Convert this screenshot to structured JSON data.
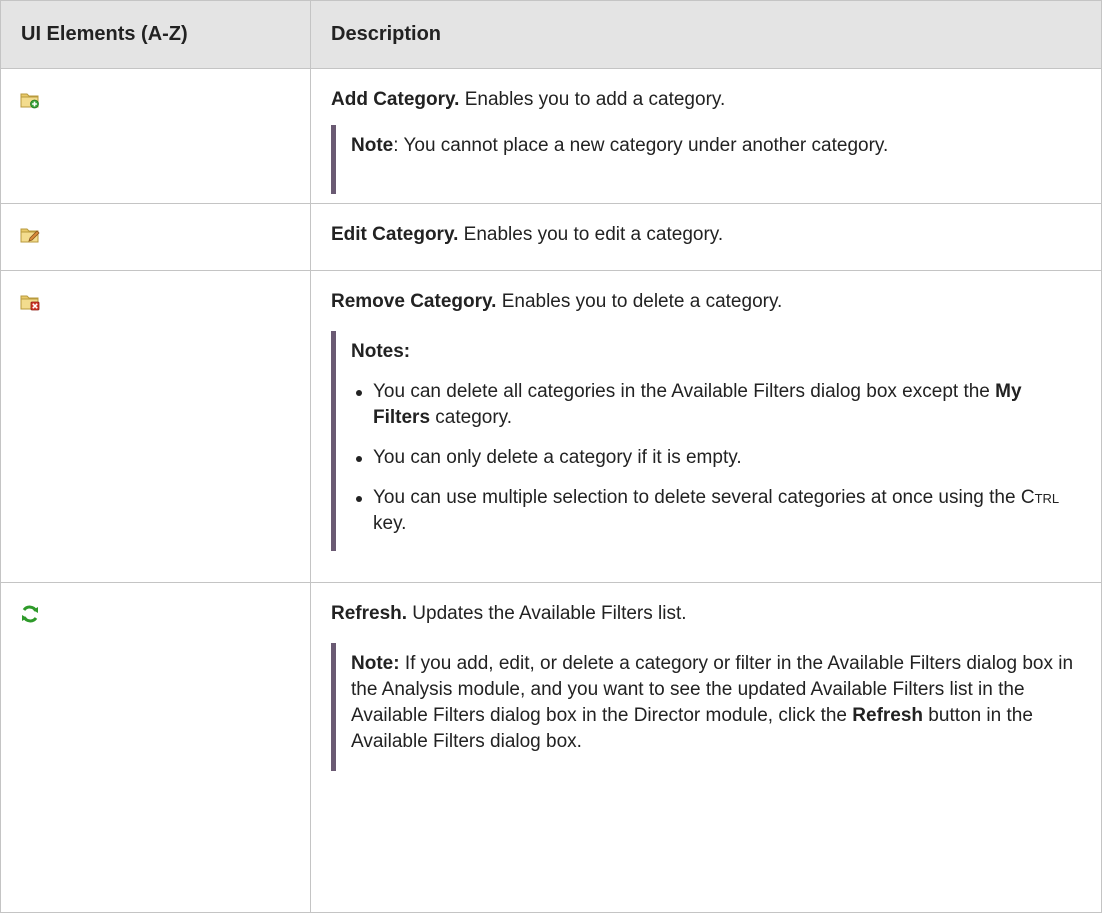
{
  "table": {
    "headers": [
      "UI Elements (A-Z)",
      "Description"
    ],
    "rows": [
      {
        "icon": "folder-add-icon",
        "title": "Add Category.",
        "text": " Enables you to add a category.",
        "note_label": "Note",
        "note_text": ": You cannot place a new category under another category."
      },
      {
        "icon": "folder-edit-icon",
        "title": "Edit Category.",
        "text": " Enables you to edit a category."
      },
      {
        "icon": "folder-remove-icon",
        "title": "Remove Category.",
        "text": " Enables you to delete a category.",
        "note_label": "Notes:",
        "bullets": [
          {
            "pre": "You can delete all categories in the Available Filters dialog box except the ",
            "bold": "My Filters",
            "post": " category."
          },
          {
            "text": "You can only delete a category if it is empty."
          },
          {
            "pre": "You can use multiple selection to delete several categories at once using the ",
            "caps_first": "C",
            "caps_rest": "trl",
            "post": " key."
          }
        ]
      },
      {
        "icon": "refresh-icon",
        "title": "Refresh.",
        "text": " Updates the Available Filters list.",
        "note_label": "Note:",
        "note_pre": " If you add, edit, or delete a category or filter in the Available Filters dialog box in the Analysis module, and you want to see the updated Available Filters list in the Available Filters dialog box in the Director module, click the ",
        "note_bold": "Refresh",
        "note_post": " button in the Available Filters dialog box."
      }
    ]
  },
  "colors": {
    "header_bg": "#e4e4e4",
    "border": "#c4c4c4",
    "note_bar": "#6a5a73",
    "refresh_green": "#2e9a2a",
    "folder_yellow": "#e9c96a"
  }
}
